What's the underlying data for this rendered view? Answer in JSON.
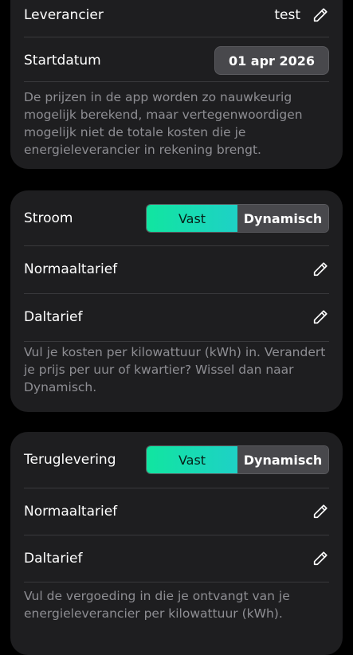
{
  "colors": {
    "background": "#000000",
    "card": "#1e1e20",
    "accent_start": "#11e5a0",
    "accent_end": "#1ed1c6",
    "muted_text": "#8e8e93"
  },
  "supplier_card": {
    "supplier_label": "Leverancier",
    "supplier_value": "test",
    "start_date_label": "Startdatum",
    "start_date_value": "01 apr 2026",
    "note": "De prijzen in de app worden zo nauwkeurig mogelijk berekend, maar vertegenwoordigen mogelijk niet de totale kosten die je energieleverancier in rekening brengt."
  },
  "electricity_card": {
    "title": "Stroom",
    "option_fixed": "Vast",
    "option_dynamic": "Dynamisch",
    "selected": "Vast",
    "normal_rate_label": "Normaaltarief",
    "off_peak_rate_label": "Daltarief",
    "note": "Vul je kosten per kilowattuur (kWh) in. Verandert je prijs per uur of kwartier? Wissel dan naar Dynamisch."
  },
  "feed_in_card": {
    "title": "Teruglevering",
    "option_fixed": "Vast",
    "option_dynamic": "Dynamisch",
    "selected": "Vast",
    "normal_rate_label": "Normaaltarief",
    "off_peak_rate_label": "Daltarief",
    "note": "Vul de vergoeding in die je ontvangt van je energieleverancier per kilowattuur (kWh)."
  }
}
